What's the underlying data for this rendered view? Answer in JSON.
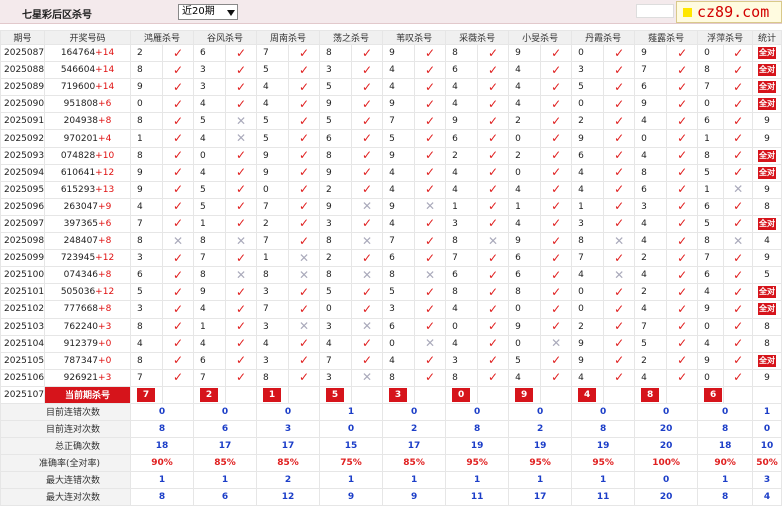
{
  "header": {
    "title": "七星彩后区杀号",
    "period_select": "近20期",
    "logo_text": "cz89.com"
  },
  "columns": [
    "期号",
    "开奖号码",
    "鸿雁杀号",
    "谷风杀号",
    "周南杀号",
    "荡之杀号",
    "苇叹杀号",
    "采薇杀号",
    "小旻杀号",
    "丹霞杀号",
    "薤露杀号",
    "浮萍杀号",
    "统计"
  ],
  "rows": [
    {
      "p": "2025087",
      "d": "164764",
      "s": "+14",
      "k": [
        "2",
        "6",
        "7",
        "8",
        "9",
        "8",
        "9",
        "0",
        "9",
        "0"
      ],
      "m": [
        1,
        1,
        1,
        1,
        1,
        1,
        1,
        1,
        1,
        1
      ],
      "stat": "全对"
    },
    {
      "p": "2025088",
      "d": "546604",
      "s": "+14",
      "k": [
        "8",
        "3",
        "5",
        "3",
        "4",
        "6",
        "4",
        "3",
        "7",
        "8"
      ],
      "m": [
        1,
        1,
        1,
        1,
        1,
        1,
        1,
        1,
        1,
        1
      ],
      "stat": "全对"
    },
    {
      "p": "2025089",
      "d": "719600",
      "s": "+14",
      "k": [
        "9",
        "3",
        "4",
        "5",
        "4",
        "4",
        "4",
        "5",
        "6",
        "7"
      ],
      "m": [
        1,
        1,
        1,
        1,
        1,
        1,
        1,
        1,
        1,
        1
      ],
      "stat": "全对"
    },
    {
      "p": "2025090",
      "d": "951808",
      "s": "+6",
      "k": [
        "0",
        "4",
        "4",
        "9",
        "9",
        "4",
        "4",
        "0",
        "9",
        "0"
      ],
      "m": [
        1,
        1,
        1,
        1,
        1,
        1,
        1,
        1,
        1,
        1
      ],
      "stat": "全对"
    },
    {
      "p": "2025091",
      "d": "204938",
      "s": "+8",
      "k": [
        "8",
        "5",
        "5",
        "5",
        "7",
        "9",
        "2",
        "2",
        "4",
        "6"
      ],
      "m": [
        1,
        0,
        1,
        1,
        1,
        1,
        1,
        1,
        1,
        1
      ],
      "stat": "9"
    },
    {
      "p": "2025092",
      "d": "970201",
      "s": "+4",
      "k": [
        "1",
        "4",
        "5",
        "6",
        "5",
        "6",
        "0",
        "9",
        "0",
        "1"
      ],
      "m": [
        1,
        0,
        1,
        1,
        1,
        1,
        1,
        1,
        1,
        1
      ],
      "stat": "9"
    },
    {
      "p": "2025093",
      "d": "074828",
      "s": "+10",
      "k": [
        "8",
        "0",
        "9",
        "8",
        "9",
        "2",
        "2",
        "6",
        "4",
        "8"
      ],
      "m": [
        1,
        1,
        1,
        1,
        1,
        1,
        1,
        1,
        1,
        1
      ],
      "stat": "全对"
    },
    {
      "p": "2025094",
      "d": "610641",
      "s": "+12",
      "k": [
        "9",
        "4",
        "9",
        "9",
        "4",
        "4",
        "0",
        "4",
        "8",
        "5"
      ],
      "m": [
        1,
        1,
        1,
        1,
        1,
        1,
        1,
        1,
        1,
        1
      ],
      "stat": "全对"
    },
    {
      "p": "2025095",
      "d": "615293",
      "s": "+13",
      "k": [
        "9",
        "5",
        "0",
        "2",
        "4",
        "4",
        "4",
        "4",
        "6",
        "1"
      ],
      "m": [
        1,
        1,
        1,
        1,
        1,
        1,
        1,
        1,
        1,
        0
      ],
      "stat": "9"
    },
    {
      "p": "2025096",
      "d": "263047",
      "s": "+9",
      "k": [
        "4",
        "5",
        "7",
        "9",
        "9",
        "1",
        "1",
        "1",
        "3",
        "6"
      ],
      "m": [
        1,
        1,
        1,
        0,
        0,
        1,
        1,
        1,
        1,
        1
      ],
      "stat": "8"
    },
    {
      "p": "2025097",
      "d": "397365",
      "s": "+6",
      "k": [
        "7",
        "1",
        "2",
        "3",
        "4",
        "3",
        "4",
        "3",
        "4",
        "5"
      ],
      "m": [
        1,
        1,
        1,
        1,
        1,
        1,
        1,
        1,
        1,
        1
      ],
      "stat": "全对"
    },
    {
      "p": "2025098",
      "d": "248407",
      "s": "+8",
      "k": [
        "8",
        "8",
        "7",
        "8",
        "7",
        "8",
        "9",
        "8",
        "4",
        "8"
      ],
      "m": [
        0,
        0,
        1,
        0,
        1,
        0,
        1,
        0,
        1,
        0
      ],
      "stat": "4"
    },
    {
      "p": "2025099",
      "d": "723945",
      "s": "+12",
      "k": [
        "3",
        "7",
        "1",
        "2",
        "6",
        "7",
        "6",
        "7",
        "2",
        "7"
      ],
      "m": [
        1,
        1,
        0,
        1,
        1,
        1,
        1,
        1,
        1,
        1
      ],
      "stat": "9"
    },
    {
      "p": "2025100",
      "d": "074346",
      "s": "+8",
      "k": [
        "6",
        "8",
        "8",
        "8",
        "8",
        "6",
        "6",
        "4",
        "4",
        "6"
      ],
      "m": [
        1,
        0,
        0,
        0,
        0,
        1,
        1,
        0,
        1,
        1
      ],
      "stat": "5"
    },
    {
      "p": "2025101",
      "d": "505036",
      "s": "+12",
      "k": [
        "5",
        "9",
        "3",
        "5",
        "5",
        "8",
        "8",
        "0",
        "2",
        "4"
      ],
      "m": [
        1,
        1,
        1,
        1,
        1,
        1,
        1,
        1,
        1,
        1
      ],
      "stat": "全对"
    },
    {
      "p": "2025102",
      "d": "777668",
      "s": "+8",
      "k": [
        "3",
        "4",
        "7",
        "0",
        "3",
        "4",
        "0",
        "0",
        "4",
        "9"
      ],
      "m": [
        1,
        1,
        1,
        1,
        1,
        1,
        1,
        1,
        1,
        1
      ],
      "stat": "全对"
    },
    {
      "p": "2025103",
      "d": "762240",
      "s": "+3",
      "k": [
        "8",
        "1",
        "3",
        "3",
        "6",
        "0",
        "9",
        "2",
        "7",
        "0"
      ],
      "m": [
        1,
        1,
        0,
        0,
        1,
        1,
        1,
        1,
        1,
        1
      ],
      "stat": "8"
    },
    {
      "p": "2025104",
      "d": "912379",
      "s": "+0",
      "k": [
        "4",
        "4",
        "4",
        "4",
        "0",
        "4",
        "0",
        "9",
        "5",
        "4"
      ],
      "m": [
        1,
        1,
        1,
        1,
        0,
        1,
        0,
        1,
        1,
        1
      ],
      "stat": "8"
    },
    {
      "p": "2025105",
      "d": "787347",
      "s": "+0",
      "k": [
        "8",
        "6",
        "3",
        "7",
        "4",
        "3",
        "5",
        "9",
        "2",
        "9"
      ],
      "m": [
        1,
        1,
        1,
        1,
        1,
        1,
        1,
        1,
        1,
        1
      ],
      "stat": "全对"
    },
    {
      "p": "2025106",
      "d": "926921",
      "s": "+3",
      "k": [
        "7",
        "7",
        "8",
        "3",
        "8",
        "8",
        "4",
        "4",
        "4",
        "0"
      ],
      "m": [
        1,
        1,
        1,
        0,
        1,
        1,
        1,
        1,
        1,
        1
      ],
      "stat": "9"
    }
  ],
  "current": {
    "p": "2025107",
    "label": "当前期杀号",
    "k": [
      "7",
      "2",
      "1",
      "5",
      "3",
      "0",
      "9",
      "4",
      "8",
      "6"
    ]
  },
  "summary": [
    {
      "label": "目前连错次数",
      "v": [
        "0",
        "0",
        "0",
        "1",
        "0",
        "0",
        "0",
        "0",
        "0",
        "0"
      ],
      "t": "1",
      "red": false
    },
    {
      "label": "目前连对次数",
      "v": [
        "8",
        "6",
        "3",
        "0",
        "2",
        "8",
        "2",
        "8",
        "20",
        "8"
      ],
      "t": "0",
      "red": false
    },
    {
      "label": "总正确次数",
      "v": [
        "18",
        "17",
        "17",
        "15",
        "17",
        "19",
        "19",
        "19",
        "20",
        "18"
      ],
      "t": "10",
      "red": false
    },
    {
      "label": "准确率(全对率)",
      "v": [
        "90%",
        "85%",
        "85%",
        "75%",
        "85%",
        "95%",
        "95%",
        "95%",
        "100%",
        "90%"
      ],
      "t": "50%",
      "red": true
    },
    {
      "label": "最大连错次数",
      "v": [
        "1",
        "1",
        "2",
        "1",
        "1",
        "1",
        "1",
        "1",
        "0",
        "1"
      ],
      "t": "3",
      "red": false
    },
    {
      "label": "最大连对次数",
      "v": [
        "8",
        "6",
        "12",
        "9",
        "9",
        "11",
        "17",
        "11",
        "20",
        "8"
      ],
      "t": "4",
      "red": false
    }
  ]
}
